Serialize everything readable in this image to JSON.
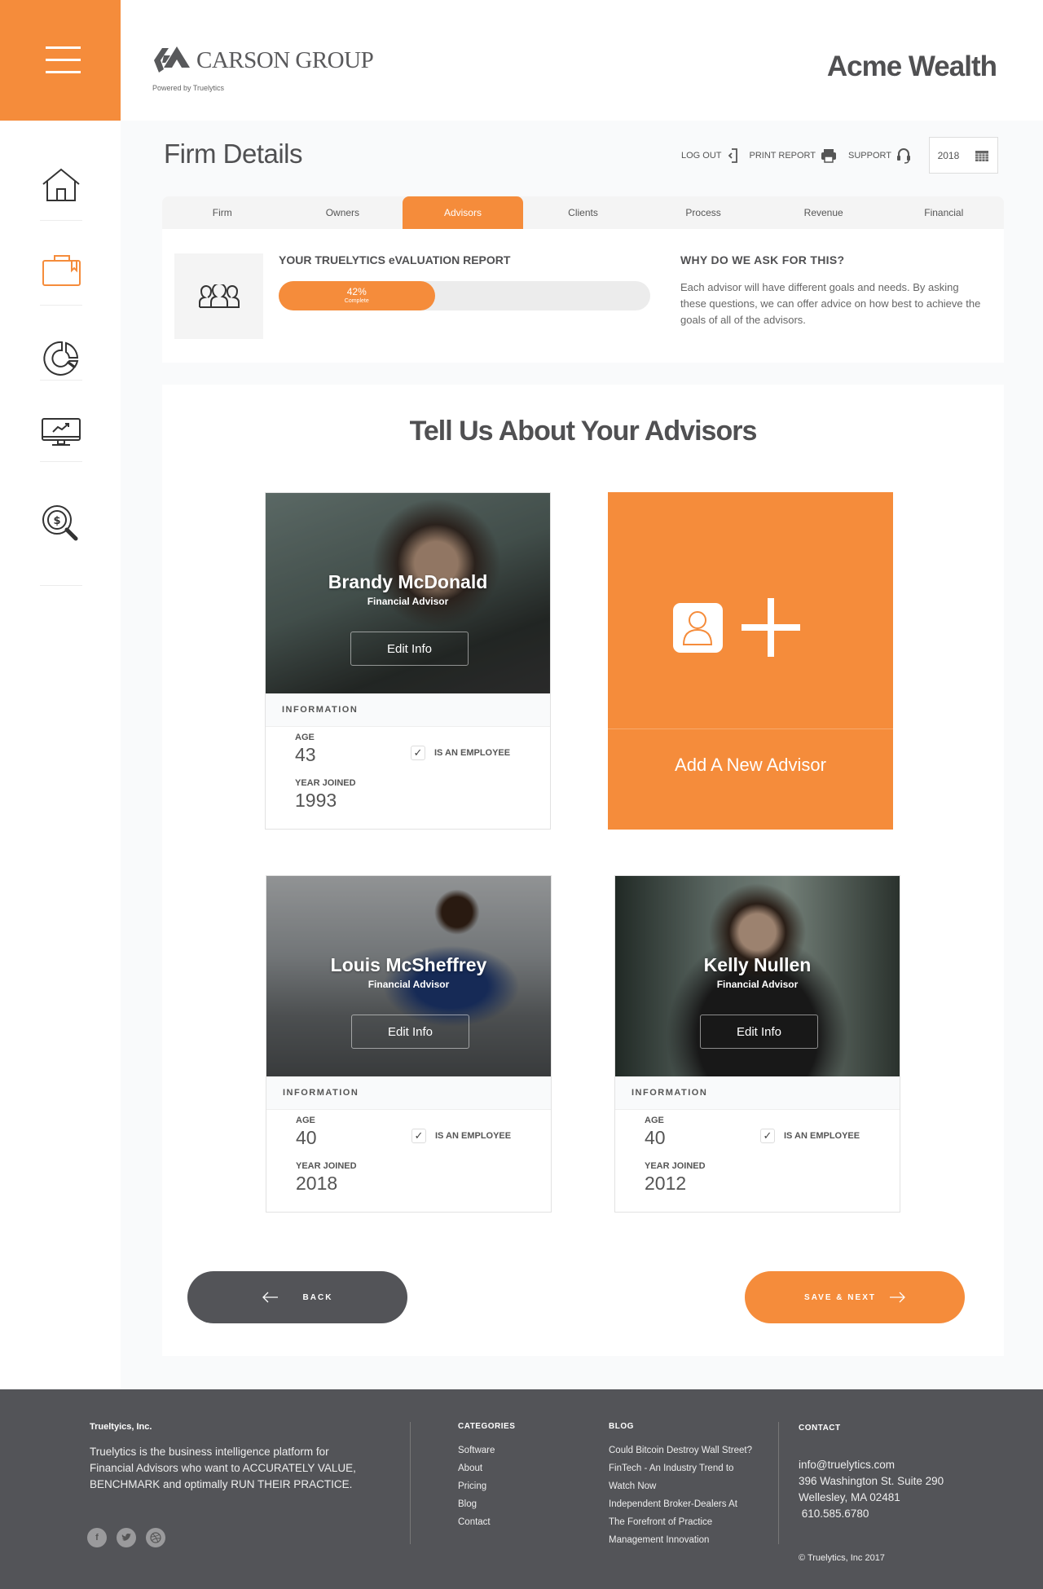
{
  "header": {
    "logo_text": "CARSON GROUP",
    "powered_by": "Powered by Truelytics",
    "firm_name": "Acme Wealth"
  },
  "sidebar": {
    "items": [
      {
        "name": "home",
        "icon": "home-icon",
        "active": false
      },
      {
        "name": "briefcase",
        "icon": "briefcase-icon",
        "active": true
      },
      {
        "name": "analytics",
        "icon": "pie-chart-icon",
        "active": false
      },
      {
        "name": "performance",
        "icon": "monitor-chart-icon",
        "active": false
      },
      {
        "name": "valuation",
        "icon": "dollar-search-icon",
        "active": false
      }
    ]
  },
  "page": {
    "title": "Firm Details",
    "toolbar": {
      "logout": "LOG OUT",
      "print": "PRINT REPORT",
      "support": "SUPPORT",
      "year": "2018"
    }
  },
  "tabs": [
    {
      "label": "Firm"
    },
    {
      "label": "Owners"
    },
    {
      "label": "Advisors",
      "active": true
    },
    {
      "label": "Clients"
    },
    {
      "label": "Process"
    },
    {
      "label": "Revenue"
    },
    {
      "label": "Financial"
    }
  ],
  "report": {
    "title": "YOUR TRUELYTICS eVALUATION REPORT",
    "progress_percent": 42,
    "progress_text": "42%",
    "progress_label": "Complete",
    "why_title": "WHY DO WE ASK FOR THIS?",
    "why_text": "Each advisor will have different goals and needs. By asking these questions, we can offer advice on how best to achieve the goals of all of the advisors."
  },
  "main": {
    "title": "Tell Us About Your Advisors",
    "info_label": "INFORMATION",
    "age_label": "AGE",
    "year_label": "YEAR JOINED",
    "employee_label": "IS AN EMPLOYEE",
    "edit_label": "Edit Info",
    "add_label": "Add A New Advisor",
    "advisors": [
      {
        "name": "Brandy McDonald",
        "role": "Financial Advisor",
        "age": "43",
        "year_joined": "1993",
        "is_employee": true
      },
      {
        "name": "Louis McSheffrey",
        "role": "Financial Advisor",
        "age": "40",
        "year_joined": "2018",
        "is_employee": true
      },
      {
        "name": "Kelly Nullen",
        "role": "Financial Advisor",
        "age": "40",
        "year_joined": "2012",
        "is_employee": true
      }
    ],
    "back_label": "BACK",
    "save_label": "SAVE & NEXT"
  },
  "footer": {
    "company": "Trueltyics, Inc.",
    "description": "Truelytics is the business intelligence platform for Financial Advisors who want to ACCURATELY VALUE, BENCHMARK and optimally RUN THEIR PRACTICE.",
    "social": [
      "facebook-icon",
      "twitter-icon",
      "dribbble-icon"
    ],
    "categories_title": "CATEGORIES",
    "categories": [
      "Software",
      "About",
      "Pricing",
      "Blog",
      "Contact"
    ],
    "blog_title": "BLOG",
    "blog": [
      "Could Bitcoin Destroy Wall Street?",
      "FinTech - An Industry Trend to",
      "Watch Now",
      "Independent Broker-Dealers At",
      "The Forefront of Practice",
      "Management Innovation"
    ],
    "contact_title": "CONTACT",
    "email": "info@truelytics.com",
    "address1": "396 Washington St. Suite 290",
    "address2": "Wellesley, MA 02481",
    "phone": " 610.585.6780",
    "copyright": "© Truelytics, Inc  2017"
  },
  "colors": {
    "accent": "#f58c3b",
    "dark": "#535458",
    "background": "#f9fafb"
  }
}
